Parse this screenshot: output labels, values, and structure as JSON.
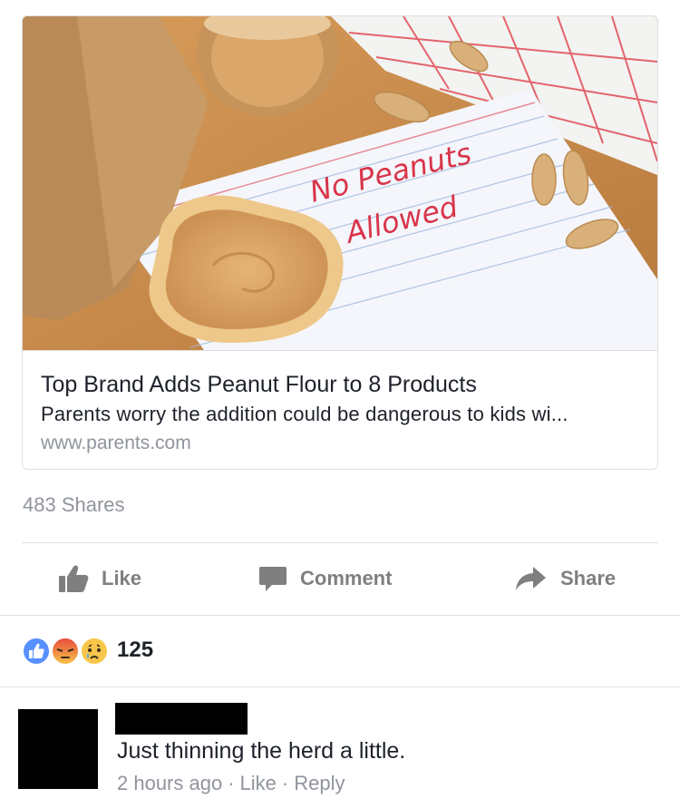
{
  "link_card": {
    "image": {
      "note_line1": "No Peanuts",
      "note_line2": "Allowed",
      "colors": {
        "wood": "#c98f4e",
        "paper": "#f4f6fb",
        "peanut_butter": "#d8a466",
        "napkin_check": "#e04a55",
        "bag": "#b98a58"
      }
    },
    "title": "Top Brand Adds Peanut Flour to 8 Products",
    "description": "Parents worry the addition could be dangerous to kids wi...",
    "domain": "www.parents.com"
  },
  "shares_text": "483 Shares",
  "actions": {
    "like_label": "Like",
    "comment_label": "Comment",
    "share_label": "Share",
    "icons": [
      "thumbs-up-icon",
      "comment-bubble-icon",
      "share-arrow-icon"
    ],
    "color": "#7f7f7f"
  },
  "reactions": {
    "icons": [
      "like-reaction-icon",
      "angry-reaction-icon",
      "sad-reaction-icon"
    ],
    "count": "125"
  },
  "comment": {
    "text": "Just thinning the herd a little.",
    "time": "2 hours ago",
    "like_label": "Like",
    "reply_label": "Reply",
    "separator": "·"
  }
}
